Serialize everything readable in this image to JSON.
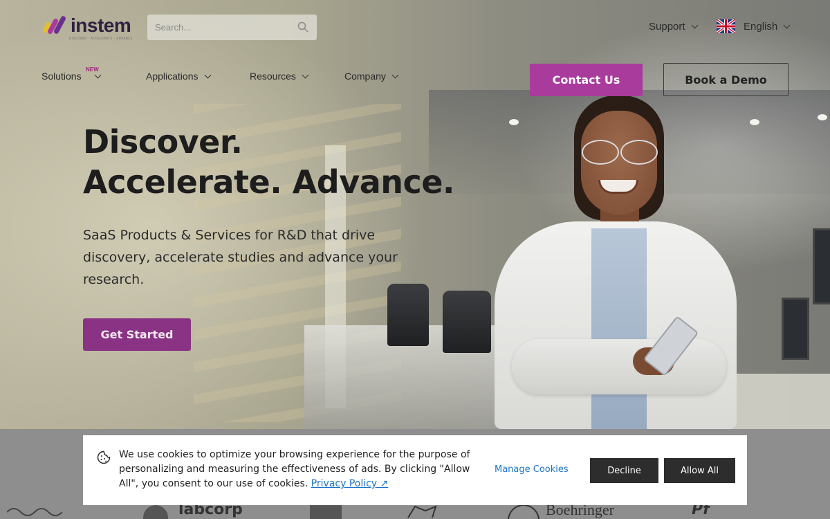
{
  "header": {
    "logo_text": "instem",
    "logo_tagline": "DISCOVER · ACCELERATE · ADVANCE",
    "search_placeholder": "Search...",
    "support_label": "Support",
    "language_label": "English"
  },
  "nav": {
    "items": [
      {
        "label": "Solutions",
        "badge": "NEW"
      },
      {
        "label": "Applications"
      },
      {
        "label": "Resources"
      },
      {
        "label": "Company"
      }
    ],
    "contact_label": "Contact Us",
    "demo_label": "Book a Demo"
  },
  "hero": {
    "headline_line1": "Discover.",
    "headline_line2": "Accelerate. Advance.",
    "subtitle": "SaaS Products & Services for R&D that drive discovery, accelerate studies and advance your research.",
    "cta_label": "Get Started"
  },
  "partners": {
    "items": [
      {
        "label": "labcorp"
      },
      {
        "label": "Boehringer"
      },
      {
        "label": "Pf"
      }
    ]
  },
  "cookie": {
    "message": "We use cookies to optimize your browsing experience for the purpose of personalizing and measuring the effectiveness of ads. By clicking \"Allow All\", you consent to our use of cookies.",
    "privacy_link": "Privacy Policy ↗",
    "manage_label": "Manage Cookies",
    "decline_label": "Decline",
    "allow_label": "Allow All"
  },
  "colors": {
    "brand_purple": "#a93b9c",
    "cta_purple": "#8a3284",
    "link_blue": "#1a73c8",
    "logo_text": "#2d2140"
  },
  "icons": [
    "search-icon",
    "chevron-down-icon",
    "uk-flag-icon",
    "cookie-icon",
    "external-link-icon"
  ]
}
